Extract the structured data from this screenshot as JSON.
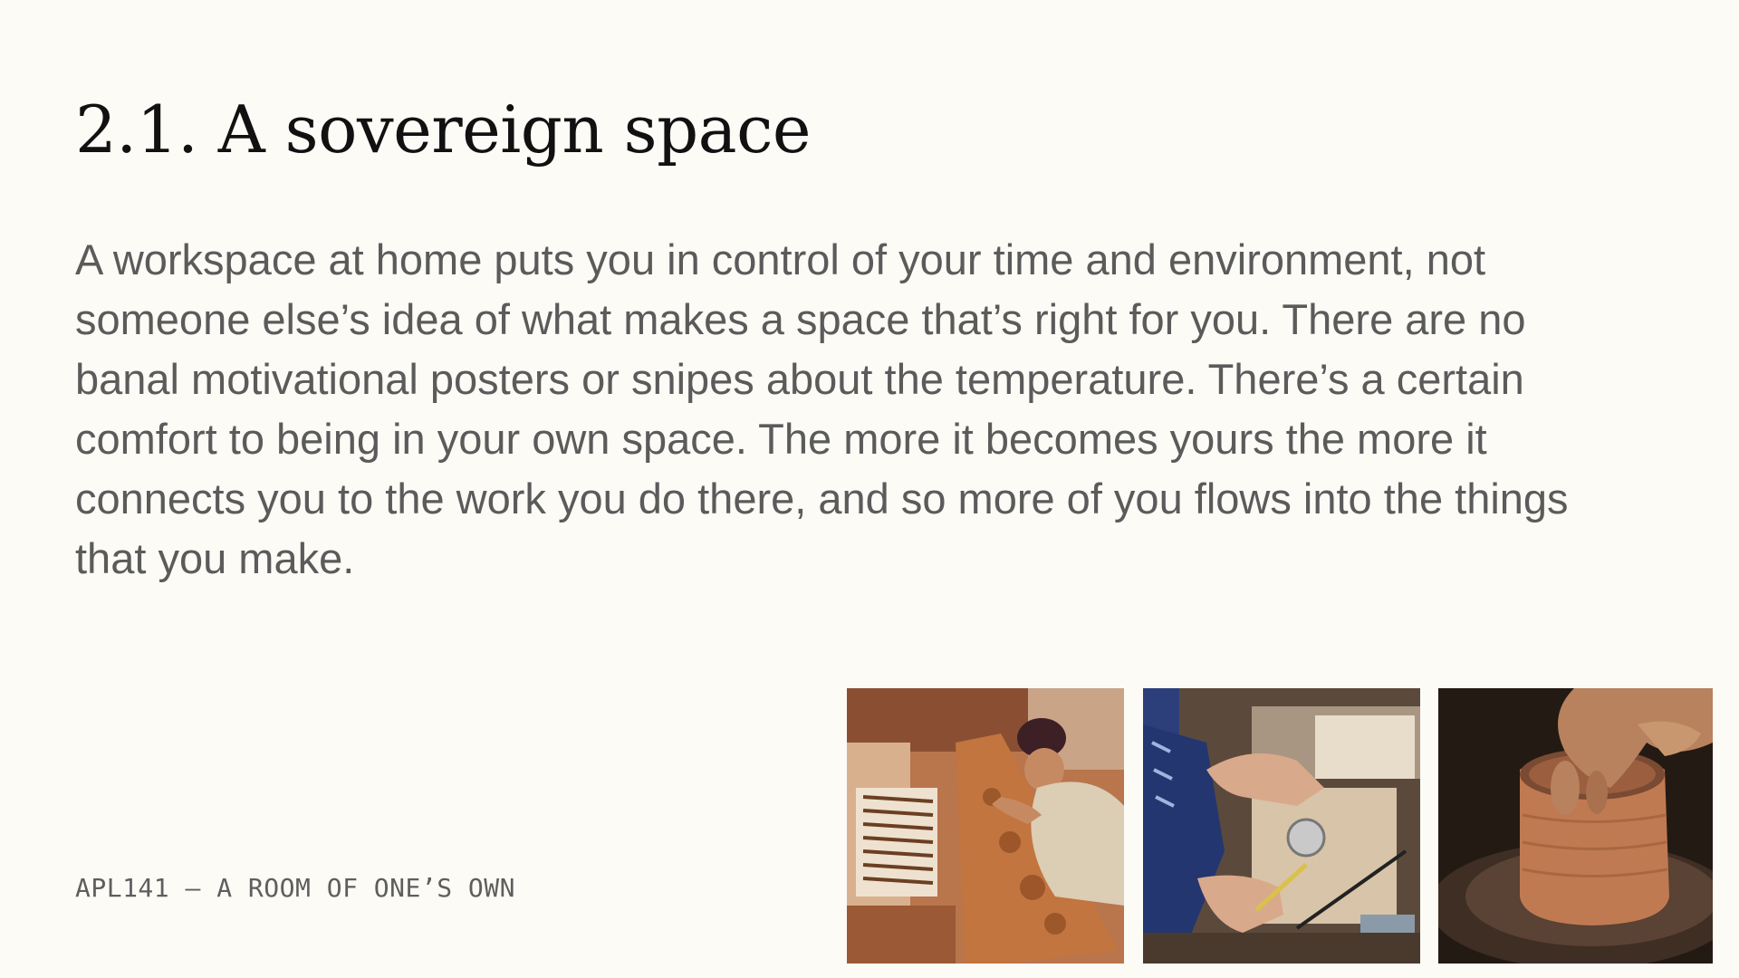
{
  "slide": {
    "title": "2.1. A sovereign space",
    "body": "A workspace at home puts you in control of your time and environment, not someone else’s idea of what makes a space that’s right for you. There are no banal motivational posters or snipes about the temperature. There’s a certain comfort to being in your own space. The more it becomes yours the more it connects you to the work you do there, and so more of you flows into the things that you make.",
    "footer": "APL141 – A ROOM OF ONE’S OWN"
  },
  "photos": [
    {
      "name": "woodcarver-photo"
    },
    {
      "name": "watchmaker-photo"
    },
    {
      "name": "pottery-wheel-photo"
    }
  ]
}
